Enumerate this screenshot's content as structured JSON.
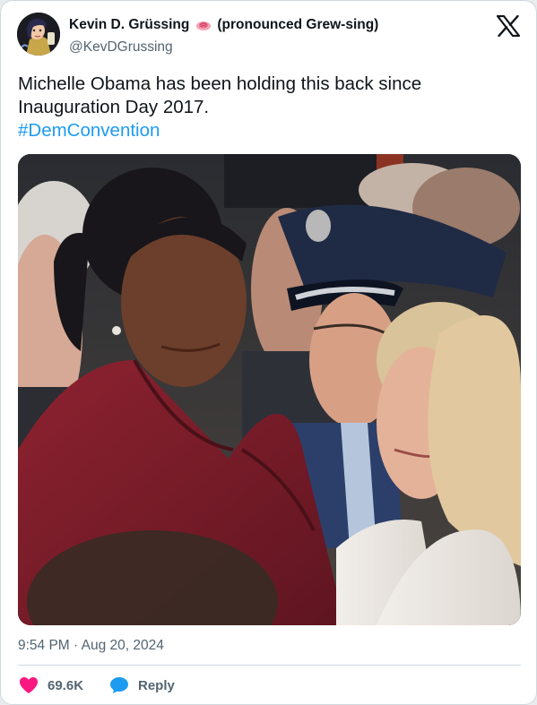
{
  "author": {
    "display_name": "Kevin D. Grüssing",
    "pronunciation": "(pronounced Grew-sing)",
    "handle": "@KevDGrussing",
    "avatar_icon": "illustrated-avatar"
  },
  "platform_icon": "x-logo-icon",
  "tweet": {
    "text": "Michelle Obama has been holding this back since Inauguration Day 2017.",
    "hashtag": "#DemConvention"
  },
  "timestamp": "9:54 PM · Aug 20, 2024",
  "actions": {
    "likes": "69.6K",
    "reply_label": "Reply"
  },
  "colors": {
    "like_heart": "#f91880",
    "reply_bubble": "#1d9bf0",
    "hashtag": "#1d9bf0",
    "secondary_text": "#536471"
  }
}
